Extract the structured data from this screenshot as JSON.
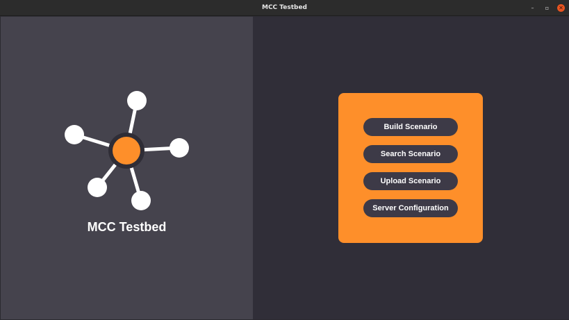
{
  "window": {
    "title": "MCC Testbed",
    "controls": {
      "minimize": "–",
      "maximize": "▫",
      "close": "✕"
    }
  },
  "left": {
    "app_name": "MCC Testbed",
    "logo_icon": "network-hub-icon"
  },
  "menu": {
    "build_scenario": "Build Scenario",
    "search_scenario": "Search Scenario",
    "upload_scenario": "Upload Scenario",
    "server_configuration": "Server Configuration"
  },
  "colors": {
    "accent": "#fe8f2a",
    "button_bg": "#3d3a47",
    "left_panel": "#45434d",
    "right_panel": "#302e38",
    "close_button": "#e95420"
  }
}
